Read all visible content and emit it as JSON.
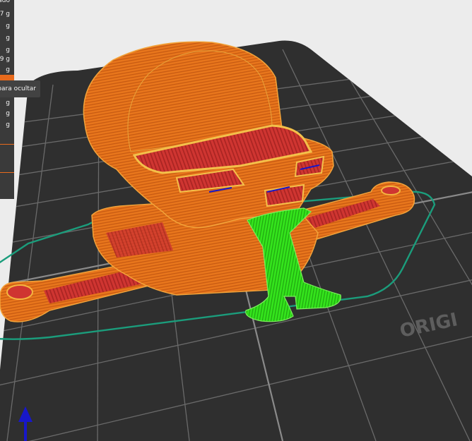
{
  "legend": {
    "header": "ado",
    "rows": [
      "7 g",
      "g",
      "g",
      "g",
      "9 g",
      "g",
      "g",
      "g",
      "g"
    ],
    "tooltip": "para ocultar"
  },
  "bed": {
    "origin_label": "ORIGI"
  },
  "colors": {
    "perimeter": "#e8761c",
    "infill": "#cf3531",
    "support": "#33e21b",
    "skirt": "#1b9d7c",
    "bed": "#2f2f2f",
    "axis": "#1717c9"
  },
  "icons": {
    "axis": "z-axis-arrow-icon"
  }
}
